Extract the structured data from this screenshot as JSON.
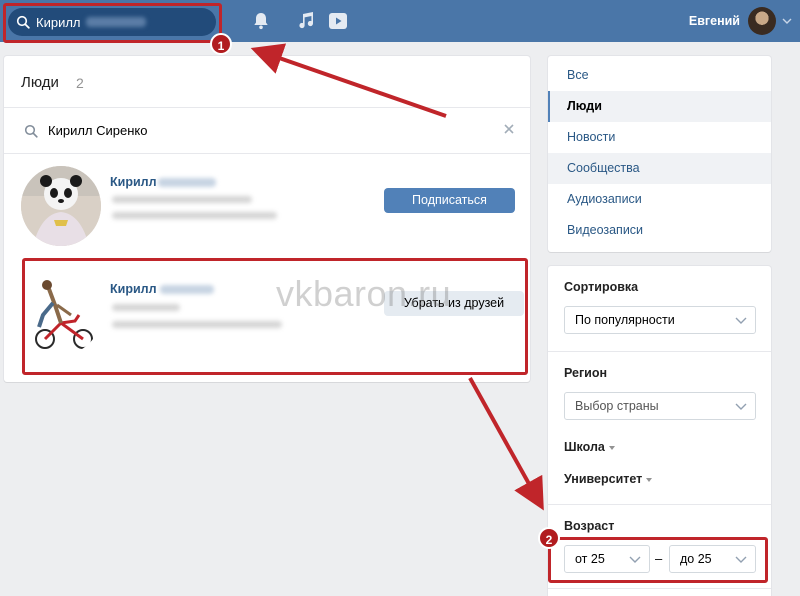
{
  "topbar": {
    "search_query": "Кирилл",
    "icons": [
      "bell-icon",
      "music-icon",
      "video-icon"
    ],
    "user_name": "Евгений"
  },
  "people": {
    "title": "Люди",
    "count": "2",
    "search_value": "Кирилл Сиренко",
    "results": [
      {
        "name": "Кирилл",
        "button": "Подписаться"
      },
      {
        "name": "Кирилл",
        "button": "Убрать из друзей"
      }
    ]
  },
  "menu": {
    "items": [
      "Все",
      "Люди",
      "Новости",
      "Сообщества",
      "Аудиозаписи",
      "Видеозаписи"
    ],
    "active": "Люди"
  },
  "filters": {
    "sort_label": "Сортировка",
    "sort_value": "По популярности",
    "region_label": "Регион",
    "region_placeholder": "Выбор страны",
    "school_label": "Школа",
    "university_label": "Университет",
    "age_label": "Возраст",
    "age_from": "от 25",
    "age_dash": "–",
    "age_to": "до 25"
  },
  "watermark": "vkbaron.ru",
  "annotations": {
    "badge1": "1",
    "badge2": "2"
  },
  "colors": {
    "header": "#4a76a8",
    "accent": "#5181b8",
    "link": "#2a5885",
    "annotation": "#c0252a"
  }
}
